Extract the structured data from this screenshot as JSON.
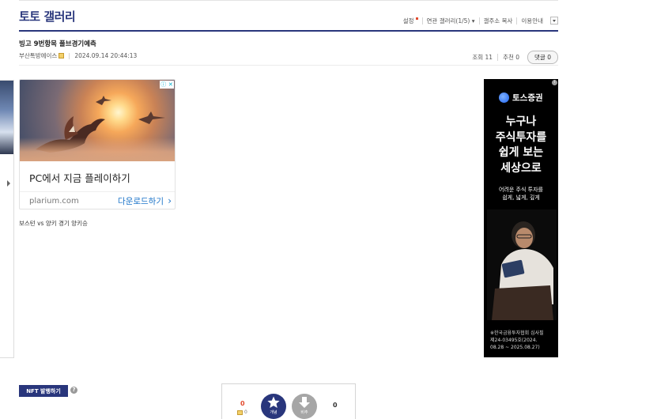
{
  "gallery": {
    "title": "토토 갤러리"
  },
  "header_links": {
    "settings": "설정",
    "related": "연관 갤러리(1/5)",
    "copy_address": "갤주소 복사",
    "guide": "이용안내"
  },
  "post": {
    "title": "빙고 9번항목 풀브경기예측",
    "author": "부산톡방에이스",
    "date": "2024.09.14 20:44:13",
    "views_label": "조회 11",
    "recommend_label": "추천 0",
    "comments_label": "댓글 0",
    "body": "보스턴 vs 양키 경기 양키승"
  },
  "ad_main": {
    "headline": "PC에서 지금 플레이하기",
    "domain": "plarium.com",
    "cta": "다운로드하기",
    "chevron": "›"
  },
  "ad_side": {
    "brand": "토스증권",
    "headline_lines": [
      "누구나",
      "주식투자를",
      "쉽게 보는",
      "세상으로"
    ],
    "sub_lines": [
      "어려운 주식 투자를",
      "쉽게, 넓게, 깊게"
    ],
    "legal_lines": [
      "※한국금융투자협회 심사필",
      "제24-03495호(2024.",
      "08.28 ~ 2025.08.27)"
    ]
  },
  "bottom": {
    "nft_button": "NFT 발행하기",
    "help": "?",
    "vote_up_count": "0",
    "fix_count": "0",
    "vote_up_label": "개념",
    "vote_down_label": "비추",
    "vote_down_count": "0"
  },
  "colors": {
    "brand_navy": "#29367c",
    "accent_red": "#e24b2e",
    "link_blue": "#1a73c8"
  }
}
